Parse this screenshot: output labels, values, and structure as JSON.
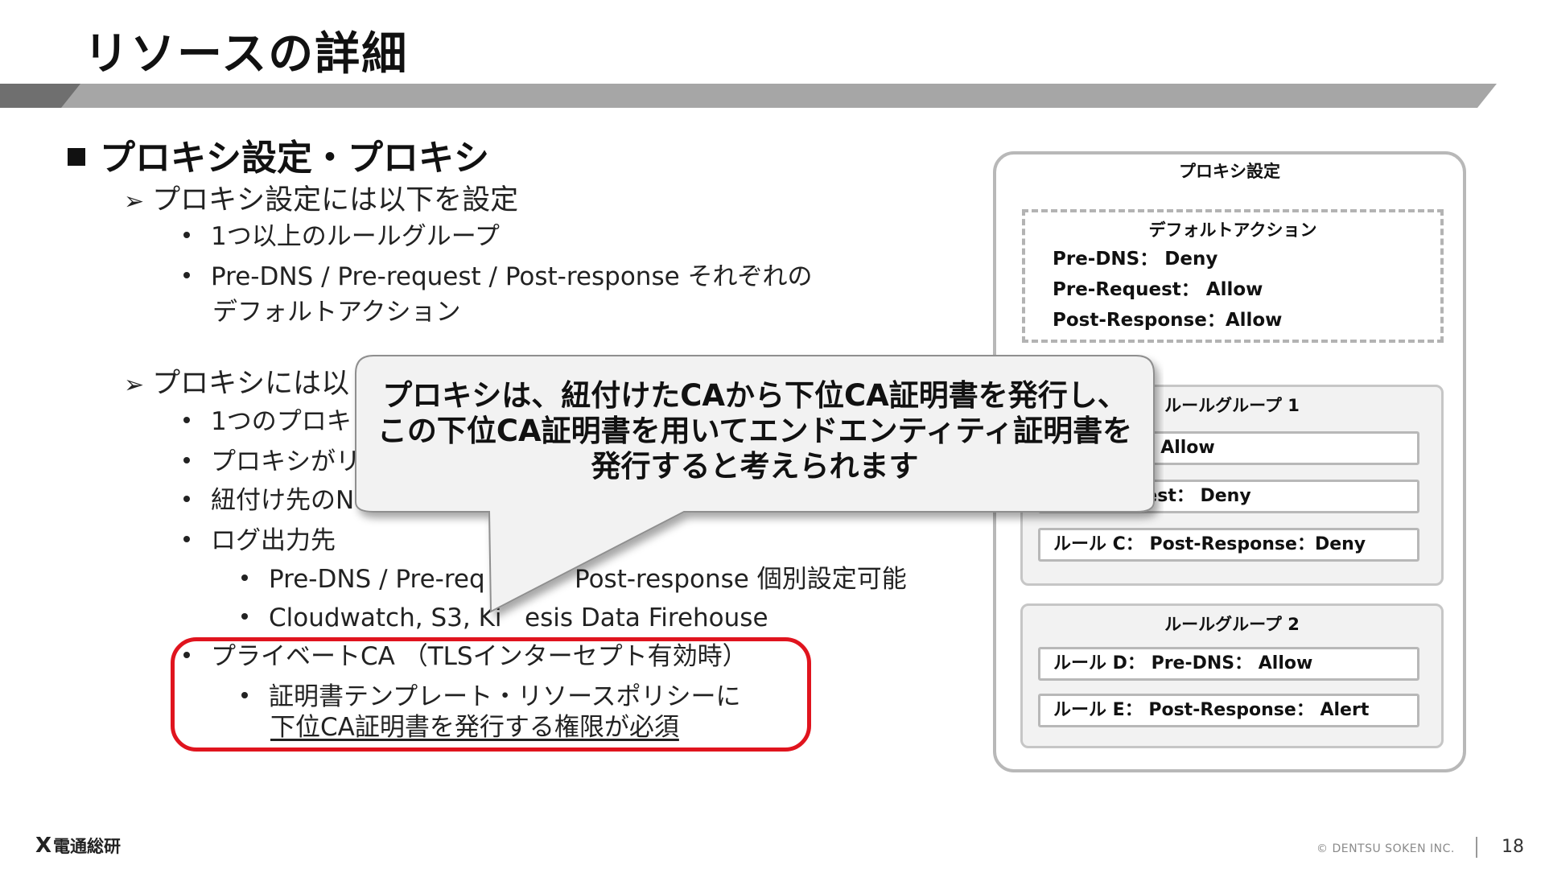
{
  "slide": {
    "title": "リソースの詳細",
    "section_heading": "プロキシ設定・プロキシ",
    "settings_heading": "プロキシ設定には以下を設定",
    "settings_items": [
      "1つ以上のルールグループ",
      "Pre-DNS / Pre-request / Post-response それぞれの",
      "デフォルトアクション"
    ],
    "proxy_heading": "プロキシには以",
    "proxy_items": [
      "1つのプロキ",
      "プロキシがリ",
      "紐付け先のN",
      "ログ出力先"
    ],
    "log_items": [
      "Pre-DNS / Pre-req",
      "Post-response 個別設定可能",
      "Cloudwatch, S3, Ki",
      "esis Data Firehouse"
    ],
    "ca_item": "プライベートCA （TLSインターセプト有効時）",
    "ca_sub_line1": "証明書テンプレート・リソースポリシーに",
    "ca_sub_line2": "下位CA証明書を発行する権限が必須"
  },
  "callout": {
    "line1": "プロキシは、紐付けたCAから下位CA証明書を発行し、",
    "line2": "この下位CA証明書を用いてエンドエンティティ証明書を",
    "line3": "発行すると考えられます"
  },
  "diagram": {
    "title": "プロキシ設定",
    "default_title": "デフォルトアクション",
    "default_lines": [
      "Pre-DNS： Deny",
      "Pre-Request： Allow",
      "Post-Response：Allow"
    ],
    "group1_title": "ルールグループ 1",
    "group1_rules": [
      "Pre-DNS： Allow",
      "Pre-Request： Deny",
      "ルール C： Post-Response：Deny"
    ],
    "group2_title": "ルールグループ 2",
    "group2_rules": [
      "ルール D： Pre-DNS： Allow",
      "ルール E： Post-Response： Alert"
    ]
  },
  "footer": {
    "logo_mark": "X",
    "logo_text": "電通総研",
    "copyright": "© DENTSU SOKEN INC.",
    "page_number": "18"
  },
  "colors": {
    "band_dark": "#6f6f6f",
    "band_light": "#a6a6a6",
    "highlight_red": "#e0141e",
    "callout_fill": "#f2f2f2"
  }
}
